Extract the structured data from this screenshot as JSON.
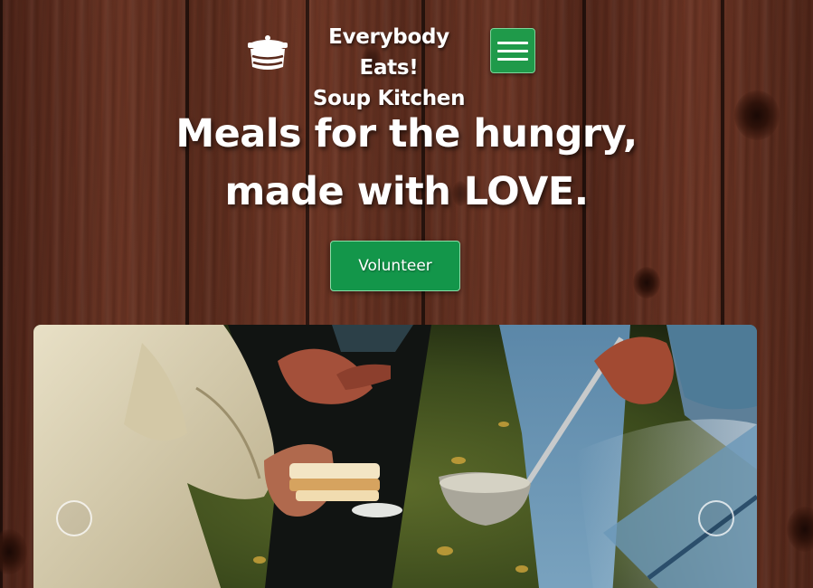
{
  "header": {
    "logo_icon": "soup-pot-icon",
    "brand_line1": "Everybody Eats!",
    "brand_line2": "Soup Kitchen",
    "menu_icon": "hamburger-menu-icon"
  },
  "hero": {
    "title_line1": "Meals for the hungry,",
    "title_line2": "made with LOVE.",
    "cta_label": "Volunteer"
  },
  "carousel": {
    "prev_icon": "carousel-prev-circle-icon",
    "next_icon": "carousel-next-circle-icon"
  },
  "colors": {
    "accent_green": "#13964a",
    "wood_brown": "#5a2a1c"
  }
}
